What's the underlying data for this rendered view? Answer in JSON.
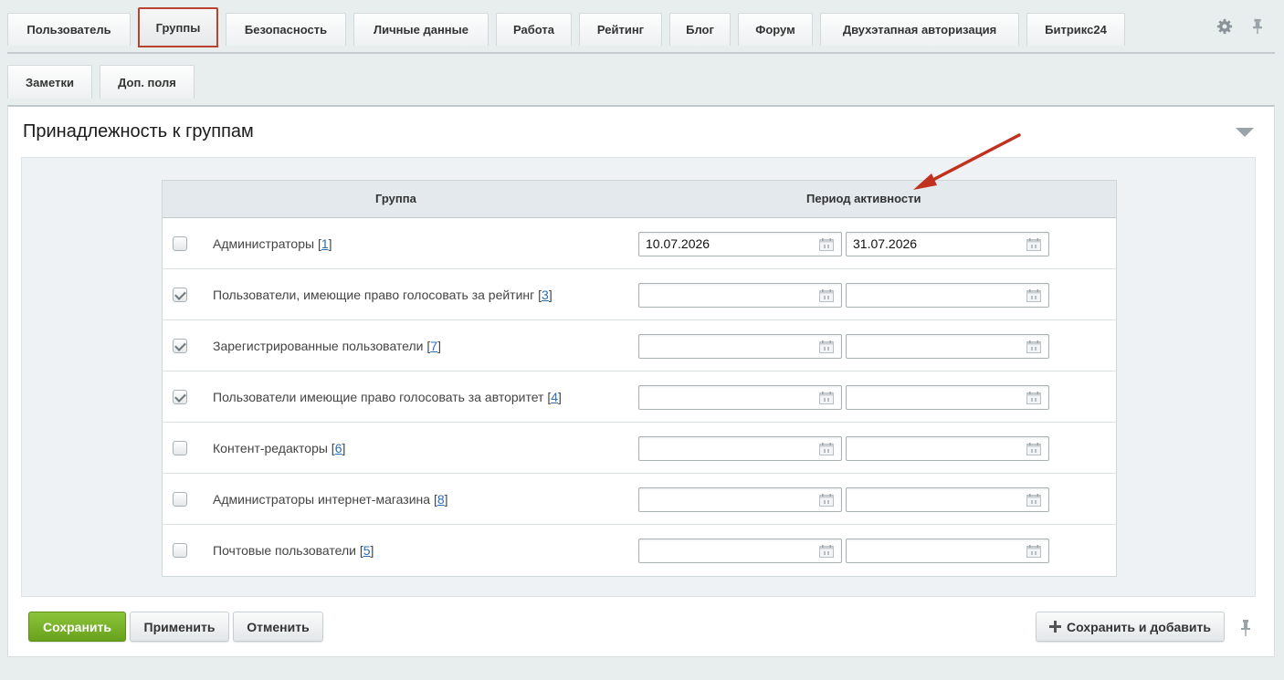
{
  "tabs_primary": [
    {
      "label": "Пользователь",
      "active": false
    },
    {
      "label": "Группы",
      "active": true
    },
    {
      "label": "Безопасность",
      "active": false
    },
    {
      "label": "Личные данные",
      "active": false
    },
    {
      "label": "Работа",
      "active": false
    },
    {
      "label": "Рейтинг",
      "active": false
    },
    {
      "label": "Блог",
      "active": false
    },
    {
      "label": "Форум",
      "active": false
    },
    {
      "label": "Двухэтапная авторизация",
      "active": false
    },
    {
      "label": "Битрикс24",
      "active": false
    }
  ],
  "tabs_secondary": [
    {
      "label": "Заметки"
    },
    {
      "label": "Доп. поля"
    }
  ],
  "section": {
    "title": "Принадлежность к группам"
  },
  "table": {
    "col_group": "Группа",
    "col_period": "Период активности",
    "rows": [
      {
        "checked": false,
        "name": "Администраторы",
        "id": "1",
        "from": "10.07.2026",
        "to": "31.07.2026"
      },
      {
        "checked": true,
        "name": "Пользователи, имеющие право голосовать за рейтинг",
        "id": "3",
        "from": "",
        "to": ""
      },
      {
        "checked": true,
        "name": "Зарегистрированные пользователи",
        "id": "7",
        "from": "",
        "to": ""
      },
      {
        "checked": true,
        "name": "Пользователи имеющие право голосовать за авторитет",
        "id": "4",
        "from": "",
        "to": ""
      },
      {
        "checked": false,
        "name": "Контент-редакторы",
        "id": "6",
        "from": "",
        "to": ""
      },
      {
        "checked": false,
        "name": "Администраторы интернет-магазина",
        "id": "8",
        "from": "",
        "to": ""
      },
      {
        "checked": false,
        "name": "Почтовые пользователи",
        "id": "5",
        "from": "",
        "to": ""
      }
    ]
  },
  "buttons": {
    "save": "Сохранить",
    "apply": "Применить",
    "cancel": "Отменить",
    "save_add": "Сохранить и добавить"
  },
  "icons": {
    "settings": "gear-icon",
    "pin": "pin-icon",
    "calendar": "calendar-icon",
    "collapse": "chevron-down-icon",
    "plus": "plus-icon"
  },
  "colors": {
    "active_tab_border": "#b9432d",
    "save_button": "#7ab52b",
    "link": "#2a6db5",
    "annotation_arrow": "#c0321e"
  }
}
